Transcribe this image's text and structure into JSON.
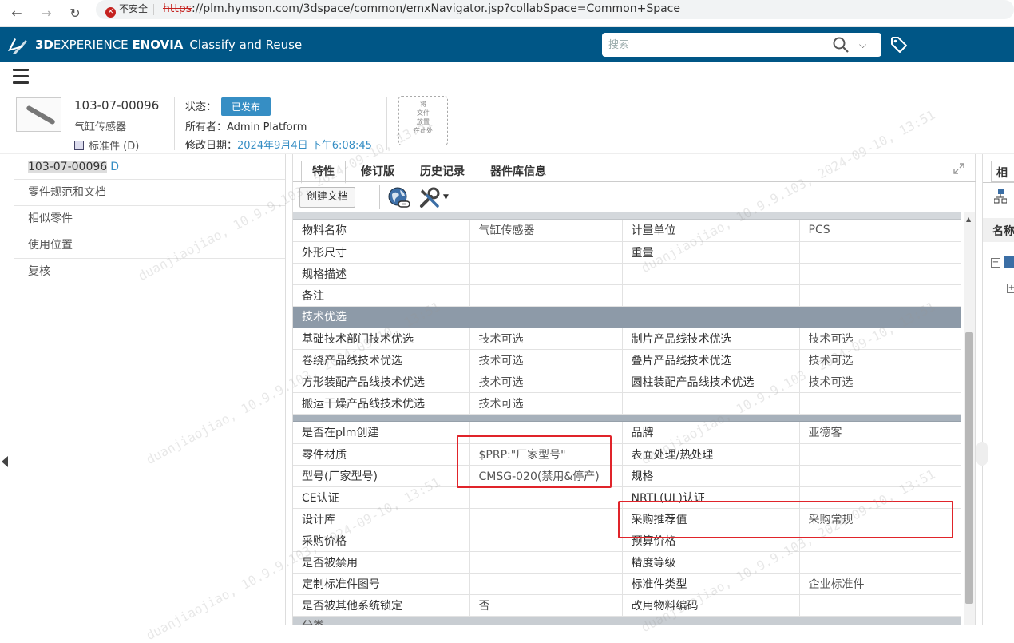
{
  "browser": {
    "back_icon": "←",
    "forward_icon": "→",
    "reload_icon": "↻",
    "security_label": "不安全",
    "url_scheme": "https",
    "url_rest": "://plm.hymson.com/3dspace/common/emxNavigator.jsp?collabSpace=Common+Space"
  },
  "header": {
    "brand_3d": "3D",
    "brand_experience": "EXPERIENCE ",
    "brand_enovia": "ENOVIA",
    "app_name": "Classify and Reuse",
    "search_placeholder": "搜索",
    "accent_color": "#005686"
  },
  "object": {
    "name": "103-07-00096",
    "description": "气缸传感器",
    "type": "标准件 (D)",
    "status_label": "状态：",
    "status_value": "已发布",
    "owner_label": "所有者：",
    "owner_value": "Admin Platform",
    "modified_label": "修改日期：",
    "modified_value": "2024年9月4日 下午6:08:45",
    "drop_zone_text": [
      "将",
      "文件",
      "放置",
      "在此处"
    ]
  },
  "left_nav": {
    "items": [
      {
        "label": "103-07-00096",
        "rev": "D"
      },
      {
        "label": "零件规范和文档"
      },
      {
        "label": "相似零件"
      },
      {
        "label": "使用位置"
      },
      {
        "label": "复核"
      }
    ]
  },
  "main": {
    "tabs": [
      "特性",
      "修订版",
      "历史记录",
      "器件库信息"
    ],
    "active_tab": "特性",
    "toolbar": {
      "create_doc": "创建文档"
    },
    "rows_basic": [
      [
        "物料名称",
        "气缸传感器",
        "计量单位",
        "PCS"
      ],
      [
        "外形尺寸",
        "",
        "重量",
        ""
      ],
      [
        "规格描述",
        "",
        "",
        ""
      ],
      [
        "备注",
        "",
        "",
        ""
      ]
    ],
    "section_tech": "技术优选",
    "rows_tech": [
      [
        "基础技术部门技术优选",
        "技术可选",
        "制片产品线技术优选",
        "技术可选"
      ],
      [
        "卷绕产品线技术优选",
        "技术可选",
        "叠片产品线技术优选",
        "技术可选"
      ],
      [
        "方形装配产品线技术优选",
        "技术可选",
        "圆柱装配产品线技术优选",
        "技术可选"
      ],
      [
        "搬运干燥产品线技术优选",
        "技术可选",
        "",
        ""
      ]
    ],
    "rows_more": [
      [
        "是否在plm创建",
        "",
        "品牌",
        "亚德客"
      ],
      [
        "零件材质",
        "$PRP:\"厂家型号\"",
        "表面处理/热处理",
        ""
      ],
      [
        "型号(厂家型号)",
        "CMSG-020(禁用&停产)",
        "规格",
        ""
      ],
      [
        "CE认证",
        "",
        "NRTL(UL)认证",
        ""
      ],
      [
        "设计库",
        "",
        "采购推荐值",
        "采购常规"
      ],
      [
        "采购价格",
        "",
        "预算价格",
        ""
      ],
      [
        "是否被禁用",
        "",
        "精度等级",
        ""
      ],
      [
        "定制标准件图号",
        "",
        "标准件类型",
        "企业标准件"
      ],
      [
        "是否被其他系统锁定",
        "否",
        "改用物料编码",
        ""
      ]
    ],
    "next_section": "分类"
  },
  "right_panel": {
    "tab_label": "相",
    "column_label": "名称"
  },
  "watermark_text": "duanjiaojiao, 10.9.9.103, 2024-09-10, 13:51"
}
